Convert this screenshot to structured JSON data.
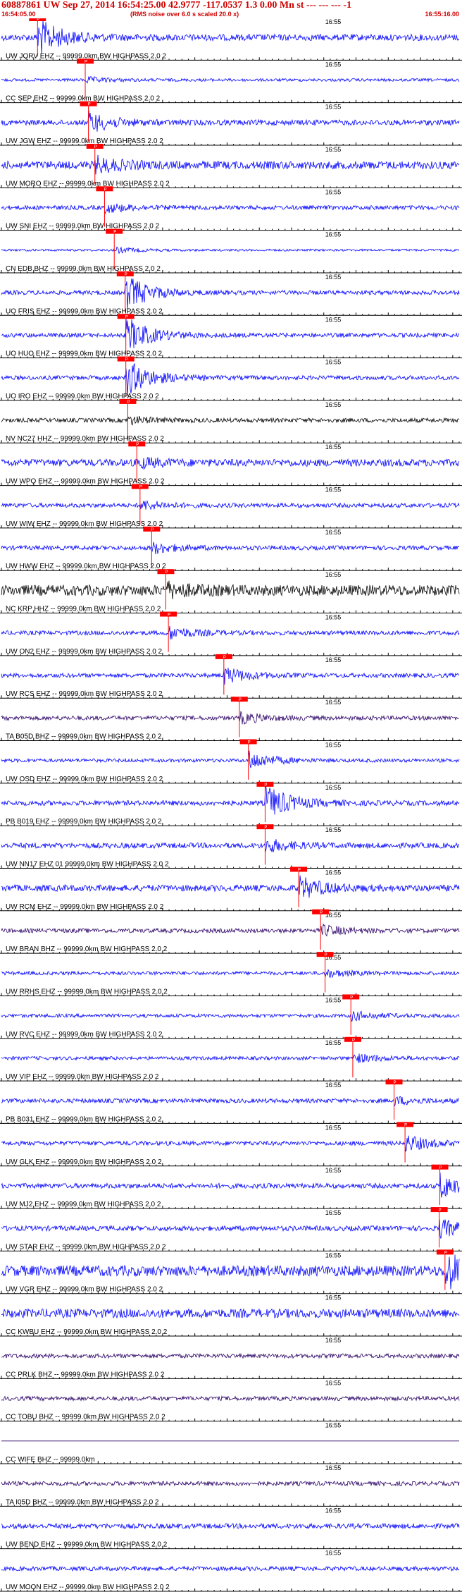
{
  "header": {
    "title": "60887861 UW Sep 27, 2014 16:54:25.00   42.9777 -117.0537  1.3 0.00 Mn st --- --- ---  -1",
    "start_time": "16:54:05.00",
    "noise_note": "(RMS noise over 6.0 s scaled 20.0 x)",
    "end_time": "16:55:16.00"
  },
  "chart_data": {
    "type": "line",
    "title": "60887861 UW Sep 27, 2014 16:54:25.00   42.9777 -117.0537  1.3 0.00 Mn st --- --- ---  -1",
    "x_start_label": "16:54:05.00",
    "x_end_label": "16:55:16.00",
    "minute_tick_label": "16:55",
    "noise_note": "(RMS noise over 6.0 s scaled 20.0 x)",
    "x_range_seconds": [
      0,
      71
    ],
    "pick_label": "P",
    "colors": {
      "blue": "#0000ff",
      "black": "#000000",
      "purple": "#2a0066",
      "pick": "#ff0000"
    },
    "channels": [
      {
        "label": "UW JQRV EHZ -- 99999.0km BW  HIGHPASS  2.0  2",
        "color": "blue",
        "pick_s": 5.6,
        "event_amp": 1.0,
        "noise_amp": 0.18
      },
      {
        "label": "CC SEP EHZ -- 99999.0km BW  HIGHPASS  2.0  2",
        "color": "blue",
        "pick_s": 13.0,
        "event_amp": 0.15,
        "noise_amp": 0.08
      },
      {
        "label": "UW JGW EHZ -- 99999.0km BW  HIGHPASS  2.0  2",
        "color": "blue",
        "pick_s": 13.5,
        "event_amp": 0.55,
        "noise_amp": 0.15
      },
      {
        "label": "UW MORO EHZ -- 99999.0km BW  HIGHPASS  2.0  2",
        "color": "blue",
        "pick_s": 14.5,
        "event_amp": 0.4,
        "noise_amp": 0.22
      },
      {
        "label": "UW SNI EHZ -- 99999.0km BW  HIGHPASS  2.0  2",
        "color": "blue",
        "pick_s": 16.0,
        "event_amp": 0.25,
        "noise_amp": 0.12
      },
      {
        "label": "CN EDB BHZ -- 99999.0km BW  HIGHPASS  2.0  2",
        "color": "blue",
        "pick_s": 17.5,
        "event_amp": 0.15,
        "noise_amp": 0.06
      },
      {
        "label": "UO FRIS EHZ -- 99999.0km BW  HIGHPASS  2.0  2",
        "color": "blue",
        "pick_s": 19.2,
        "event_amp": 1.0,
        "noise_amp": 0.12
      },
      {
        "label": "UO HUO EHZ -- 99999.0km BW  HIGHPASS  2.0  2",
        "color": "blue",
        "pick_s": 19.3,
        "event_amp": 1.0,
        "noise_amp": 0.12
      },
      {
        "label": "UO IRO EHZ -- 99999.0km BW  HIGHPASS  2.0  2",
        "color": "blue",
        "pick_s": 19.3,
        "event_amp": 1.0,
        "noise_amp": 0.12
      },
      {
        "label": "NV NC27 HHZ -- 99999.0km BW  HIGHPASS  2.0  2",
        "color": "black",
        "pick_s": 19.6,
        "event_amp": 0.2,
        "noise_amp": 0.12
      },
      {
        "label": "UW WPO EHZ -- 99999.0km BW  HIGHPASS  2.0  2",
        "color": "blue",
        "pick_s": 21.0,
        "event_amp": 0.25,
        "noise_amp": 0.2
      },
      {
        "label": "UW WIW EHZ -- 99999.0km BW  HIGHPASS  2.0  2",
        "color": "blue",
        "pick_s": 21.5,
        "event_amp": 0.25,
        "noise_amp": 0.12
      },
      {
        "label": "UW HWW EHZ -- 99999.0km BW  HIGHPASS  2.0  2",
        "color": "blue",
        "pick_s": 23.3,
        "event_amp": 0.3,
        "noise_amp": 0.12
      },
      {
        "label": "NC KRP HHZ -- 99999.0km BW  HIGHPASS  2.0  2",
        "color": "black",
        "pick_s": 25.5,
        "event_amp": 0.3,
        "noise_amp": 0.3
      },
      {
        "label": "UW ON2 EHZ -- 99999.0km BW  HIGHPASS  2.0  2",
        "color": "blue",
        "pick_s": 25.9,
        "event_amp": 0.35,
        "noise_amp": 0.12
      },
      {
        "label": "UW RCS EHZ -- 99999.0km BW  HIGHPASS  2.0  2",
        "color": "blue",
        "pick_s": 34.5,
        "event_amp": 0.45,
        "noise_amp": 0.12
      },
      {
        "label": "TA B05D BHZ -- 99999.0km BW  HIGHPASS  2.0  2",
        "color": "purple",
        "pick_s": 36.9,
        "event_amp": 0.3,
        "noise_amp": 0.12
      },
      {
        "label": "UW OSD EHZ -- 99999.0km BW  HIGHPASS  2.0  2",
        "color": "blue",
        "pick_s": 38.3,
        "event_amp": 0.5,
        "noise_amp": 0.1
      },
      {
        "label": "PB B019 EHZ -- 99999.0km BW  HIGHPASS  2.0  2",
        "color": "blue",
        "pick_s": 40.9,
        "event_amp": 1.0,
        "noise_amp": 0.14
      },
      {
        "label": "UW NN17 EHZ 01 99999.0km BW  HIGHPASS  2.0  2",
        "color": "blue",
        "pick_s": 40.9,
        "event_amp": 0.35,
        "noise_amp": 0.15
      },
      {
        "label": "UW RCM EHZ -- 99999.0km BW  HIGHPASS  2.0  2",
        "color": "blue",
        "pick_s": 46.1,
        "event_amp": 0.6,
        "noise_amp": 0.18
      },
      {
        "label": "UW BRAN BHZ -- 99999.0km BW  HIGHPASS  2.0  2",
        "color": "purple",
        "pick_s": 49.5,
        "event_amp": 0.3,
        "noise_amp": 0.12
      },
      {
        "label": "UW RRHS EHZ -- 99999.0km BW  HIGHPASS  2.0  2",
        "color": "blue",
        "pick_s": 50.2,
        "event_amp": 0.2,
        "noise_amp": 0.1
      },
      {
        "label": "UW RVC EHZ -- 99999.0km BW  HIGHPASS  2.0  2",
        "color": "blue",
        "pick_s": 54.2,
        "event_amp": 0.25,
        "noise_amp": 0.1
      },
      {
        "label": "UW VIP EHZ -- 99999.0km BW  HIGHPASS  2.0  2",
        "color": "blue",
        "pick_s": 54.5,
        "event_amp": 0.25,
        "noise_amp": 0.1
      },
      {
        "label": "PB B031 EHZ -- 99999.0km BW  HIGHPASS  2.0  2",
        "color": "blue",
        "pick_s": 60.9,
        "event_amp": 0.2,
        "noise_amp": 0.12
      },
      {
        "label": "UW GLK EHZ -- 99999.0km BW  HIGHPASS  2.0  2",
        "color": "blue",
        "pick_s": 62.6,
        "event_amp": 0.45,
        "noise_amp": 0.12
      },
      {
        "label": "UW MJ2 EHZ -- 99999.0km BW  HIGHPASS  2.0  2",
        "color": "blue",
        "pick_s": 68.0,
        "event_amp": 0.7,
        "noise_amp": 0.14
      },
      {
        "label": "UW STAR EHZ -- 99999.0km BW  HIGHPASS  2.0  2",
        "color": "blue",
        "pick_s": 67.9,
        "event_amp": 0.5,
        "noise_amp": 0.14
      },
      {
        "label": "UW VGR EHZ -- 99999.0km BW  HIGHPASS  2.0  2",
        "color": "blue",
        "pick_s": 68.8,
        "event_amp": 1.0,
        "noise_amp": 0.3
      },
      {
        "label": "CC KWBU EHZ -- 99999.0km BW  HIGHPASS  2.0  2",
        "color": "blue",
        "pick_s": null,
        "event_amp": 0,
        "noise_amp": 0.25
      },
      {
        "label": "CC PRLK BHZ -- 99999.0km BW  HIGHPASS  2.0  2",
        "color": "purple",
        "pick_s": null,
        "event_amp": 0,
        "noise_amp": 0.12
      },
      {
        "label": "CC TOBU BHZ -- 99999.0km BW  HIGHPASS  2.0  2",
        "color": "purple",
        "pick_s": null,
        "event_amp": 0,
        "noise_amp": 0.12
      },
      {
        "label": "CC WIFE BHZ -- 99999.0km",
        "color": "purple",
        "pick_s": null,
        "event_amp": 0,
        "noise_amp": 0.0
      },
      {
        "label": "TA I05D BHZ -- 99999.0km BW  HIGHPASS  2.0  2",
        "color": "purple",
        "pick_s": null,
        "event_amp": 0,
        "noise_amp": 0.12
      },
      {
        "label": "UW BEND EHZ -- 99999.0km BW  HIGHPASS  2.0  2",
        "color": "blue",
        "pick_s": null,
        "event_amp": 0,
        "noise_amp": 0.14
      },
      {
        "label": "UW MOON EHZ -- 99999.0km BW  HIGHPASS  2.0  2",
        "color": "blue",
        "pick_s": null,
        "event_amp": 0,
        "noise_amp": 0.12
      }
    ]
  }
}
